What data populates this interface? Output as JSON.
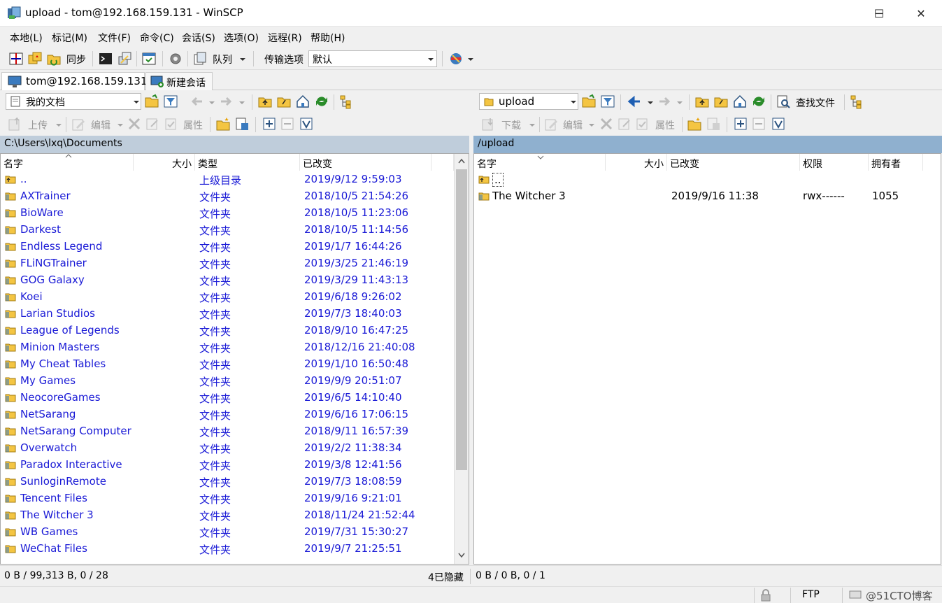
{
  "window": {
    "title": "upload - tom@192.168.159.131 - WinSCP",
    "min_glyph": "─",
    "max_glyph": "☐",
    "close_glyph": "✕"
  },
  "menu": [
    "本地(L)",
    "标记(M)",
    "文件(F)",
    "命令(C)",
    "会话(S)",
    "选项(O)",
    "远程(R)",
    "帮助(H)"
  ],
  "toolbar": {
    "sync_label": "同步",
    "queue_label": "队列",
    "transfer_options_label": "传输选项",
    "transfer_preset": "默认"
  },
  "tabs": {
    "session": "tom@192.168.159.131",
    "new_session": "新建会话"
  },
  "left": {
    "location_combo": "我的文档",
    "upload_label": "上传",
    "edit_label": "编辑",
    "props_label": "属性",
    "path": "C:\\Users\\lxq\\Documents",
    "columns": [
      "名字",
      "大小",
      "类型",
      "已改变"
    ],
    "rows": [
      {
        "name": "..",
        "size": "",
        "type": "上级目录",
        "changed": "2019/9/12  9:59:03",
        "parent": true
      },
      {
        "name": "AXTrainer",
        "size": "",
        "type": "文件夹",
        "changed": "2018/10/5  21:54:26"
      },
      {
        "name": "BioWare",
        "size": "",
        "type": "文件夹",
        "changed": "2018/10/5  11:23:06"
      },
      {
        "name": "Darkest",
        "size": "",
        "type": "文件夹",
        "changed": "2018/10/5  11:14:56"
      },
      {
        "name": "Endless Legend",
        "size": "",
        "type": "文件夹",
        "changed": "2019/1/7  16:44:26"
      },
      {
        "name": "FLiNGTrainer",
        "size": "",
        "type": "文件夹",
        "changed": "2019/3/25  21:46:19"
      },
      {
        "name": "GOG Galaxy",
        "size": "",
        "type": "文件夹",
        "changed": "2019/3/29  11:43:13"
      },
      {
        "name": "Koei",
        "size": "",
        "type": "文件夹",
        "changed": "2019/6/18  9:26:02"
      },
      {
        "name": "Larian Studios",
        "size": "",
        "type": "文件夹",
        "changed": "2019/7/3  18:40:03"
      },
      {
        "name": "League of Legends",
        "size": "",
        "type": "文件夹",
        "changed": "2018/9/10  16:47:25"
      },
      {
        "name": "Minion Masters",
        "size": "",
        "type": "文件夹",
        "changed": "2018/12/16  21:40:08"
      },
      {
        "name": "My Cheat Tables",
        "size": "",
        "type": "文件夹",
        "changed": "2019/1/10  16:50:48"
      },
      {
        "name": "My Games",
        "size": "",
        "type": "文件夹",
        "changed": "2019/9/9  20:51:07"
      },
      {
        "name": "NeocoreGames",
        "size": "",
        "type": "文件夹",
        "changed": "2019/6/5  14:10:40"
      },
      {
        "name": "NetSarang",
        "size": "",
        "type": "文件夹",
        "changed": "2019/6/16  17:06:15"
      },
      {
        "name": "NetSarang Computer",
        "size": "",
        "type": "文件夹",
        "changed": "2018/9/11  16:57:39"
      },
      {
        "name": "Overwatch",
        "size": "",
        "type": "文件夹",
        "changed": "2019/2/2  11:38:34"
      },
      {
        "name": "Paradox Interactive",
        "size": "",
        "type": "文件夹",
        "changed": "2019/3/8  12:41:56"
      },
      {
        "name": "SunloginRemote",
        "size": "",
        "type": "文件夹",
        "changed": "2019/7/3  18:08:59"
      },
      {
        "name": "Tencent Files",
        "size": "",
        "type": "文件夹",
        "changed": "2019/9/16  9:21:01"
      },
      {
        "name": "The Witcher 3",
        "size": "",
        "type": "文件夹",
        "changed": "2018/11/24  21:52:44"
      },
      {
        "name": "WB Games",
        "size": "",
        "type": "文件夹",
        "changed": "2019/7/31  15:30:27"
      },
      {
        "name": "WeChat Files",
        "size": "",
        "type": "文件夹",
        "changed": "2019/9/7  21:25:51"
      }
    ],
    "status_left": "0 B / 99,313 B,  0 / 28",
    "status_hidden": "4已隐藏"
  },
  "right": {
    "location_combo": "upload",
    "find_label": "查找文件",
    "download_label": "下载",
    "edit_label": "编辑",
    "props_label": "属性",
    "path": "/upload",
    "columns": [
      "名字",
      "大小",
      "已改变",
      "权限",
      "拥有者"
    ],
    "rows": [
      {
        "name": "..",
        "size": "",
        "changed": "",
        "rights": "",
        "owner": "",
        "parent": true
      },
      {
        "name": "The Witcher 3",
        "size": "",
        "changed": "2019/9/16 11:38",
        "rights": "rwx------",
        "owner": "1055"
      }
    ],
    "status": "0 B / 0 B,  0 / 1"
  },
  "bottom": {
    "protocol": "FTP",
    "watermark": "@51CTO博客"
  },
  "colors": {
    "path_left_bg": "#bfcddb",
    "path_right_bg": "#8fb0cf",
    "link_blue": "#1a1ad6",
    "folder_yellow": "#f4c542"
  }
}
